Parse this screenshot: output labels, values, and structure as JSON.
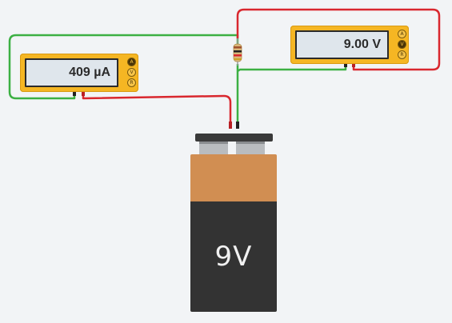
{
  "ammeter": {
    "reading": "409 µA",
    "modes": [
      "A",
      "V",
      "R"
    ],
    "active_mode": "A"
  },
  "voltmeter": {
    "reading": "9.00 V",
    "modes": [
      "A",
      "V",
      "R"
    ],
    "active_mode": "V"
  },
  "battery": {
    "label": "9V"
  },
  "colors": {
    "wire_positive": "#d9272e",
    "wire_negative": "#3cb043",
    "meter_body": "#f5b623",
    "battery_top": "#d18e52",
    "battery_bottom": "#333333"
  }
}
